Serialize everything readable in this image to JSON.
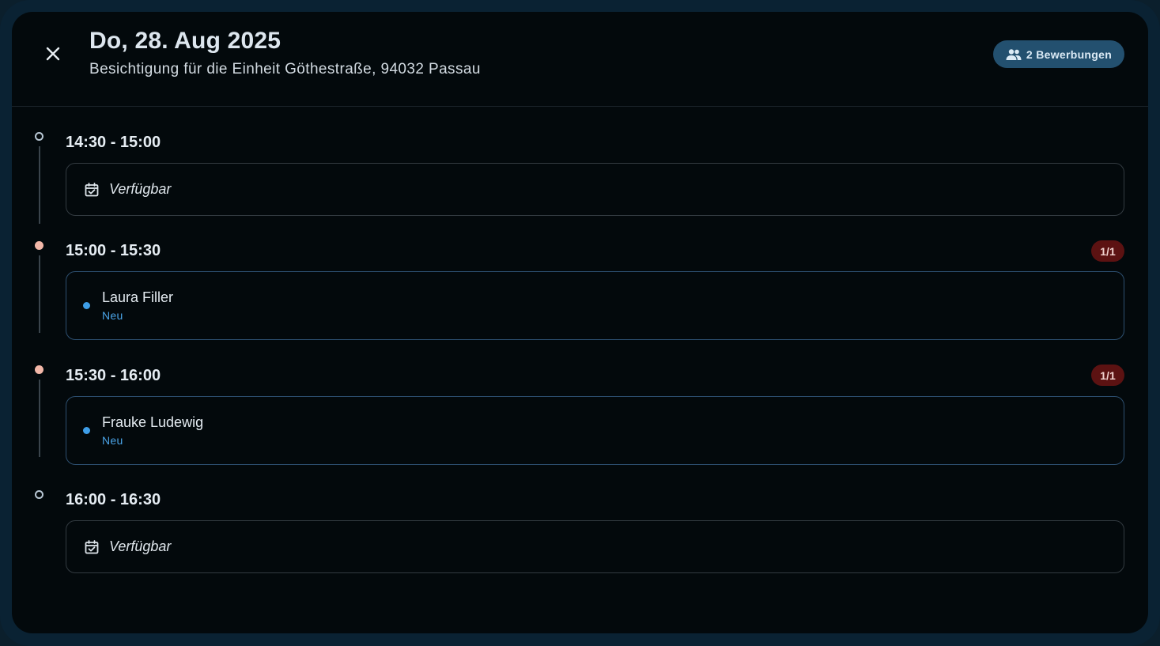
{
  "header": {
    "title": "Do, 28. Aug 2025",
    "subtitle": "Besichtigung für die Einheit Göthestraße, 94032 Passau",
    "applications_label": "2 Bewerbungen",
    "close_icon": "close-icon",
    "applications_icon": "people-icon"
  },
  "colors": {
    "accent": "#23506f",
    "booked_dot": "#f2b7a8",
    "status_new": "#3e9ee8",
    "count_badge": "#5c1212"
  },
  "slots": [
    {
      "time": "14:30 - 15:00",
      "state": "free",
      "label": "Verfügbar",
      "icon": "calendar-check-icon"
    },
    {
      "time": "15:00 - 15:30",
      "state": "booked",
      "count": "1/1",
      "name": "Laura Filler",
      "status": "Neu"
    },
    {
      "time": "15:30 - 16:00",
      "state": "booked",
      "count": "1/1",
      "name": "Frauke Ludewig",
      "status": "Neu"
    },
    {
      "time": "16:00 - 16:30",
      "state": "free",
      "label": "Verfügbar",
      "icon": "calendar-check-icon"
    }
  ]
}
